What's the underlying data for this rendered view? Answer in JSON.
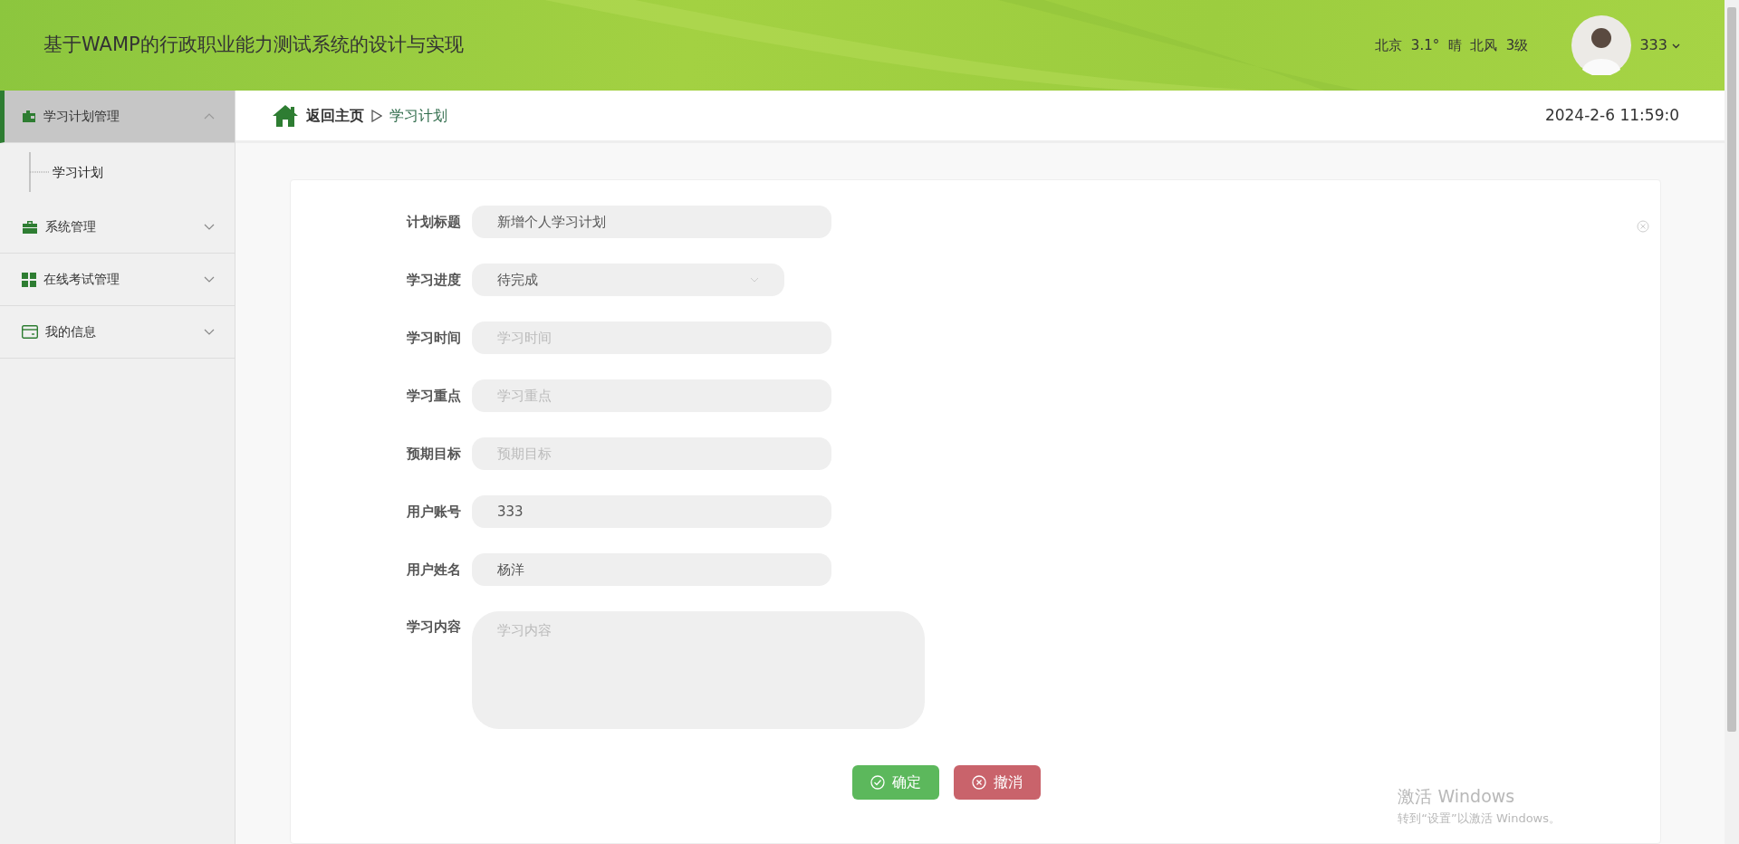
{
  "header": {
    "title": "基于WAMP的行政职业能力测试系统的设计与实现",
    "weather": "北京  3.1°  晴  北风  3级",
    "user": "333"
  },
  "sidebar": {
    "items": [
      {
        "label": "学习计划管理",
        "kind": "wallet",
        "expanded": true,
        "selected": true,
        "children": [
          {
            "label": "学习计划",
            "selected": false
          }
        ]
      },
      {
        "label": "系统管理",
        "kind": "briefcase",
        "expanded": false,
        "selected": false
      },
      {
        "label": "在线考试管理",
        "kind": "grid",
        "expanded": false,
        "selected": false
      },
      {
        "label": "我的信息",
        "kind": "card",
        "expanded": false,
        "selected": false
      }
    ]
  },
  "breadcrumb": {
    "home": "返回主页",
    "current": "学习计划",
    "datetime": "2024-2-6 11:59:0"
  },
  "form": {
    "fields": [
      {
        "label": "计划标题",
        "kind": "text",
        "value": "新增个人学习计划"
      },
      {
        "label": "学习进度",
        "kind": "select",
        "value": "待完成"
      },
      {
        "label": "学习时间",
        "kind": "text",
        "placeholder": "学习时间"
      },
      {
        "label": "学习重点",
        "kind": "text",
        "placeholder": "学习重点"
      },
      {
        "label": "预期目标",
        "kind": "text",
        "placeholder": "预期目标"
      },
      {
        "label": "用户账号",
        "kind": "text",
        "value": "333"
      },
      {
        "label": "用户姓名",
        "kind": "text",
        "value": "杨洋"
      },
      {
        "label": "学习内容",
        "kind": "textarea",
        "placeholder": "学习内容"
      }
    ],
    "buttons": [
      {
        "label": "确定",
        "kind": "confirm"
      },
      {
        "label": "撤消",
        "kind": "cancel"
      }
    ]
  },
  "os_notice": {
    "title": "激活 Windows",
    "text": "转到“设置”以激活 Windows。"
  }
}
